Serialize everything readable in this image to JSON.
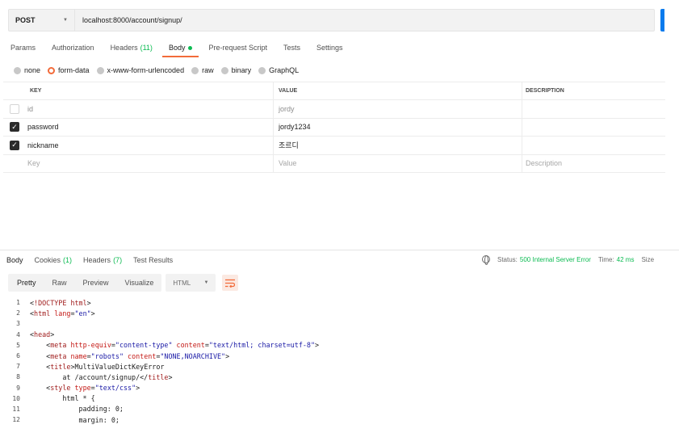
{
  "request": {
    "method": "POST",
    "url": "localhost:8000/account/signup/"
  },
  "request_tabs": [
    {
      "label": "Params",
      "count": "",
      "active": false
    },
    {
      "label": "Authorization",
      "count": "",
      "active": false
    },
    {
      "label": "Headers",
      "count": "(11)",
      "active": false
    },
    {
      "label": "Body",
      "count": "",
      "active": true
    },
    {
      "label": "Pre-request Script",
      "count": "",
      "active": false
    },
    {
      "label": "Tests",
      "count": "",
      "active": false
    },
    {
      "label": "Settings",
      "count": "",
      "active": false
    }
  ],
  "body_types": [
    {
      "label": "none",
      "selected": false
    },
    {
      "label": "form-data",
      "selected": true
    },
    {
      "label": "x-www-form-urlencoded",
      "selected": false
    },
    {
      "label": "raw",
      "selected": false
    },
    {
      "label": "binary",
      "selected": false
    },
    {
      "label": "GraphQL",
      "selected": false
    }
  ],
  "form_table": {
    "headers": {
      "key": "KEY",
      "value": "VALUE",
      "description": "DESCRIPTION"
    },
    "rows": [
      {
        "checked": false,
        "key": "id",
        "value": "jordy",
        "description": ""
      },
      {
        "checked": true,
        "key": "password",
        "value": "jordy1234",
        "description": ""
      },
      {
        "checked": true,
        "key": "nickname",
        "value": "조르디",
        "description": ""
      }
    ],
    "placeholder": {
      "key": "Key",
      "value": "Value",
      "description": "Description"
    }
  },
  "response": {
    "tabs": [
      {
        "label": "Body",
        "count": ""
      },
      {
        "label": "Cookies",
        "count": "(1)"
      },
      {
        "label": "Headers",
        "count": "(7)"
      },
      {
        "label": "Test Results",
        "count": ""
      }
    ],
    "status_label": "Status:",
    "status_value": "500 Internal Server Error",
    "time_label": "Time:",
    "time_value": "42 ms",
    "size_label": "Size",
    "views": [
      "Pretty",
      "Raw",
      "Preview",
      "Visualize"
    ],
    "active_view": "Pretty",
    "format": "HTML"
  },
  "code_lines": [
    {
      "n": "1",
      "indent": "",
      "parts": [
        [
          "p",
          "<"
        ],
        [
          "t",
          "!DOCTYPE"
        ],
        [
          "p",
          " "
        ],
        [
          "t",
          "html"
        ],
        [
          "p",
          ">"
        ]
      ]
    },
    {
      "n": "2",
      "indent": "",
      "parts": [
        [
          "p",
          "<"
        ],
        [
          "t",
          "html"
        ],
        [
          "p",
          " "
        ],
        [
          "a",
          "lang"
        ],
        [
          "p",
          "="
        ],
        [
          "s",
          "\"en\""
        ],
        [
          "p",
          ">"
        ]
      ]
    },
    {
      "n": "3",
      "indent": "",
      "parts": []
    },
    {
      "n": "4",
      "indent": "",
      "parts": [
        [
          "p",
          "<"
        ],
        [
          "t",
          "head"
        ],
        [
          "p",
          ">"
        ]
      ]
    },
    {
      "n": "5",
      "indent": "    ",
      "parts": [
        [
          "p",
          "<"
        ],
        [
          "t",
          "meta"
        ],
        [
          "p",
          " "
        ],
        [
          "a",
          "http-equiv"
        ],
        [
          "p",
          "="
        ],
        [
          "s",
          "\"content-type\""
        ],
        [
          "p",
          " "
        ],
        [
          "a",
          "content"
        ],
        [
          "p",
          "="
        ],
        [
          "s",
          "\"text/html; charset=utf-8\""
        ],
        [
          "p",
          ">"
        ]
      ]
    },
    {
      "n": "6",
      "indent": "    ",
      "parts": [
        [
          "p",
          "<"
        ],
        [
          "t",
          "meta"
        ],
        [
          "p",
          " "
        ],
        [
          "a",
          "name"
        ],
        [
          "p",
          "="
        ],
        [
          "s",
          "\"robots\""
        ],
        [
          "p",
          " "
        ],
        [
          "a",
          "content"
        ],
        [
          "p",
          "="
        ],
        [
          "s",
          "\"NONE,NOARCHIVE\""
        ],
        [
          "p",
          ">"
        ]
      ]
    },
    {
      "n": "7",
      "indent": "    ",
      "parts": [
        [
          "p",
          "<"
        ],
        [
          "t",
          "title"
        ],
        [
          "p",
          ">MultiValueDictKeyError"
        ]
      ]
    },
    {
      "n": "8",
      "indent": "        ",
      "parts": [
        [
          "p",
          "at /account/signup/</"
        ],
        [
          "t",
          "title"
        ],
        [
          "p",
          ">"
        ]
      ]
    },
    {
      "n": "9",
      "indent": "    ",
      "parts": [
        [
          "p",
          "<"
        ],
        [
          "t",
          "style"
        ],
        [
          "p",
          " "
        ],
        [
          "a",
          "type"
        ],
        [
          "p",
          "="
        ],
        [
          "s",
          "\"text/css\""
        ],
        [
          "p",
          ">"
        ]
      ]
    },
    {
      "n": "10",
      "indent": "        ",
      "parts": [
        [
          "p",
          "html * {"
        ]
      ]
    },
    {
      "n": "11",
      "indent": "            ",
      "parts": [
        [
          "p",
          "padding: 0;"
        ]
      ]
    },
    {
      "n": "12",
      "indent": "            ",
      "parts": [
        [
          "p",
          "margin: 0;"
        ]
      ]
    }
  ]
}
